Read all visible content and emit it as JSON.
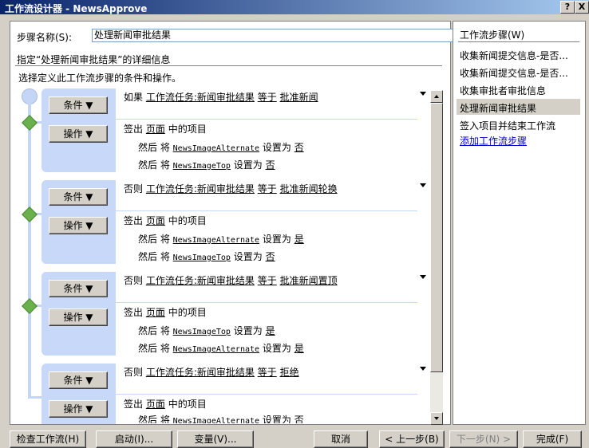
{
  "window": {
    "title": "工作流设计器 - NewsApprove",
    "help_glyph": "?",
    "close_glyph": "X"
  },
  "step_name": {
    "label": "步骤名称(S):",
    "value": "处理新闻审批结果"
  },
  "details_heading": "指定“处理新闻审批结果”的详细信息",
  "instruction": "选择定义此工作流步骤的条件和操作。",
  "condition_button_label": "条件 ▼",
  "action_button_label": "操作 ▼",
  "blocks": [
    {
      "cond_prefix": "如果",
      "field": "工作流任务:新闻审批结果",
      "op": "等于",
      "value": "批准新闻",
      "action_head": "签出",
      "action_obj": "页面",
      "action_tail": "中的项目",
      "lines": [
        {
          "pre": "然后 将",
          "field": "NewsImageAlternate",
          "mid": "设置为",
          "val": "否"
        },
        {
          "pre": "然后 将",
          "field": "NewsImageTop",
          "mid": "设置为",
          "val": "否"
        }
      ]
    },
    {
      "cond_prefix": "否则",
      "field": "工作流任务:新闻审批结果",
      "op": "等于",
      "value": "批准新闻轮换",
      "action_head": "签出",
      "action_obj": "页面",
      "action_tail": "中的项目",
      "lines": [
        {
          "pre": "然后 将",
          "field": "NewsImageAlternate",
          "mid": "设置为",
          "val": "是"
        },
        {
          "pre": "然后 将",
          "field": "NewsImageTop",
          "mid": "设置为",
          "val": "否"
        }
      ]
    },
    {
      "cond_prefix": "否则",
      "field": "工作流任务:新闻审批结果",
      "op": "等于",
      "value": "批准新闻置顶",
      "action_head": "签出",
      "action_obj": "页面",
      "action_tail": "中的项目",
      "lines": [
        {
          "pre": "然后 将",
          "field": "NewsImageTop",
          "mid": "设置为",
          "val": "是"
        },
        {
          "pre": "然后 将",
          "field": "NewsImageAlternate",
          "mid": "设置为",
          "val": "是"
        }
      ]
    },
    {
      "cond_prefix": "否则",
      "field": "工作流任务:新闻审批结果",
      "op": "等于",
      "value": "拒绝",
      "action_head": "签出",
      "action_obj": "页面",
      "action_tail": "中的项目",
      "lines": [
        {
          "pre": "然后 将",
          "field": "NewsImageAlternate",
          "mid": "设置为",
          "val": "否"
        }
      ]
    }
  ],
  "steps_panel": {
    "title": "工作流步骤(W)",
    "items": [
      "收集新闻提交信息-是否...",
      "收集新闻提交信息-是否...",
      "收集审批者审批信息",
      "处理新闻审批结果",
      "签入项目并结束工作流"
    ],
    "selected_index": 3,
    "add_link": "添加工作流步骤"
  },
  "buttons": {
    "check": "检查工作流(H)",
    "init": "启动(I)...",
    "vars": "变量(V)...",
    "cancel": "取消",
    "back": "< 上一步(B)",
    "next": "下一步(N) >",
    "finish": "完成(F)"
  }
}
